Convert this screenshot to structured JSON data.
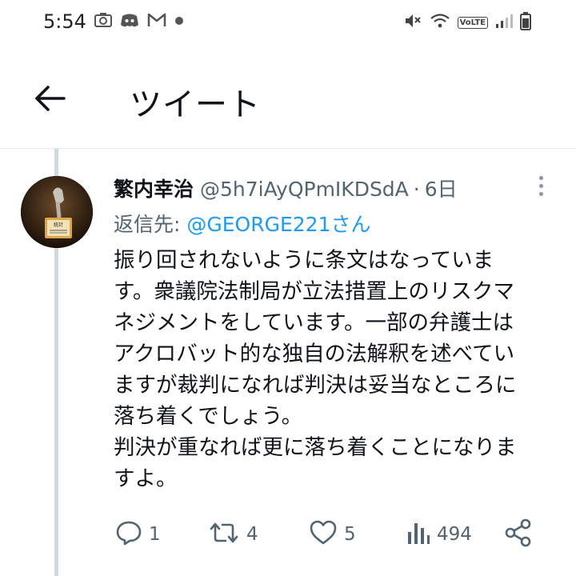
{
  "status_bar": {
    "time": "5:54",
    "left_icons": [
      "camera-icon",
      "discord-icon",
      "gmail-icon",
      "notification-dot-icon"
    ],
    "right_icons": [
      "mute-icon",
      "wifi-icon",
      "volte-icon",
      "signal-icon",
      "battery-icon"
    ],
    "volte_label": "VoLTE"
  },
  "header": {
    "back_icon": "arrow-left-icon",
    "title": "ツイート"
  },
  "tweet": {
    "author_name": "繁内幸治",
    "author_handle": "@5h7iAyQPmIKDSdA",
    "separator": "·",
    "time": "6日",
    "reply_prefix": "返信先: ",
    "reply_to": "@GEORGE221さん",
    "text_lines": [
      "振り回されないように条文はなっていま",
      "す。衆議院法制局が立法措置上のリスクマ",
      "ネジメントをしています。一部の弁護士は",
      "アクロバット的な独自の法解釈を述べてい",
      "ますが裁判になれば判決は妥当なところに",
      "落ち着くでしょう。",
      "判決が重なれば更に落ち着くことになりま",
      "すよ。"
    ],
    "avatar_text": "統計"
  },
  "actions": {
    "reply_count": "1",
    "retweet_count": "4",
    "like_count": "5",
    "view_count": "494"
  },
  "colors": {
    "link": "#1d9bf0",
    "secondary_text": "#536471",
    "primary_text": "#0f1419",
    "thread_line": "#cfd9de"
  }
}
